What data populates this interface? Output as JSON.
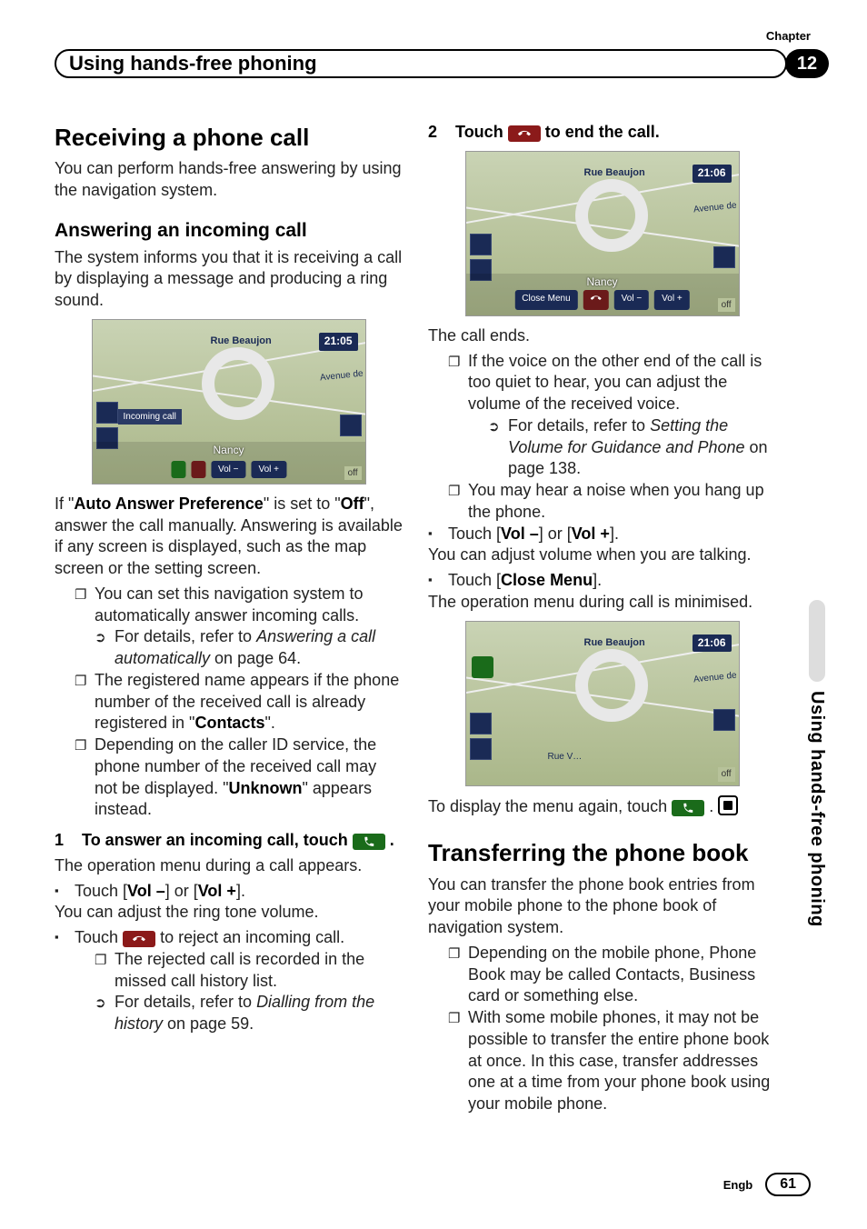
{
  "chapter": {
    "label": "Chapter",
    "number": "12"
  },
  "header": {
    "title": "Using hands-free phoning"
  },
  "sidetab": "Using hands-free phoning",
  "footer": {
    "lang": "Engb",
    "page": "61"
  },
  "shots": {
    "street": "Rue Beaujon",
    "avenue": "Avenue de",
    "caller": "Nancy",
    "incoming_chip": "Incoming call",
    "close_menu": "Close Menu",
    "vol_minus": "Vol −",
    "vol_plus": "Vol +",
    "off": "off",
    "clock1": "21:05",
    "clock2": "21:06",
    "clock3": "21:06"
  },
  "col1": {
    "h1": "Receiving a phone call",
    "p1": "You can perform hands-free answering by using the navigation system.",
    "h2": "Answering an incoming call",
    "p2": "The system informs you that it is receiving a call by displaying a message and producing a ring sound.",
    "p3a": "If \"",
    "p3b": "Auto Answer Preference",
    "p3c": "\" is set to \"",
    "p3d": "Off",
    "p3e": "\", answer the call manually. Answering is available if any screen is displayed, such as the map screen or the setting screen.",
    "li1": "You can set this navigation system to automatically answer incoming calls.",
    "li1ref_a": "For details, refer to ",
    "li1ref_b": "Answering a call automatically",
    "li1ref_c": " on page 64.",
    "li2a": "The registered name appears if the phone number of the received call is already registered in \"",
    "li2b": "Contacts",
    "li2c": "\".",
    "li3a": "Depending on the caller ID service, the phone number of the received call may not be displayed. \"",
    "li3b": "Unknown",
    "li3c": "\" appears instead.",
    "step1_num": "1",
    "step1_a": "To answer an incoming call, touch ",
    "step1_b": ".",
    "p4": "The operation menu during a call appears.",
    "li4a": "Touch [",
    "li4b": "Vol –",
    "li4c": "] or [",
    "li4d": "Vol +",
    "li4e": "].",
    "p5": "You can adjust the ring tone volume.",
    "li5a": "Touch ",
    "li5b": " to reject an incoming call.",
    "li6": "The rejected call is recorded in the missed call history list.",
    "li6ref_a": "For details, refer to ",
    "li6ref_b": "Dialling from the history",
    "li6ref_c": " on page 59."
  },
  "col2": {
    "step2_num": "2",
    "step2_a": "Touch ",
    "step2_b": " to end the call.",
    "p1": "The call ends.",
    "li1": "If the voice on the other end of the call is too quiet to hear, you can adjust the volume of the received voice.",
    "li1ref_a": "For details, refer to ",
    "li1ref_b": "Setting the Volume for Guidance and Phone",
    "li1ref_c": " on page 138.",
    "li2": "You may hear a noise when you hang up the phone.",
    "li3a": "Touch [",
    "li3b": "Vol –",
    "li3c": "] or [",
    "li3d": "Vol +",
    "li3e": "].",
    "p2": "You can adjust volume when you are talking.",
    "li4a": "Touch [",
    "li4b": "Close Menu",
    "li4c": "].",
    "p3": "The operation menu during call is minimised.",
    "p4a": "To display the menu again, touch ",
    "p4b": ".",
    "h1": "Transferring the phone book",
    "p5": "You can transfer the phone book entries from your mobile phone to the phone book of navigation system.",
    "li5": "Depending on the mobile phone, Phone Book may be called Contacts, Business card or something else.",
    "li6": "With some mobile phones, it may not be possible to transfer the entire phone book at once. In this case, transfer addresses one at a time from your phone book using your mobile phone."
  }
}
